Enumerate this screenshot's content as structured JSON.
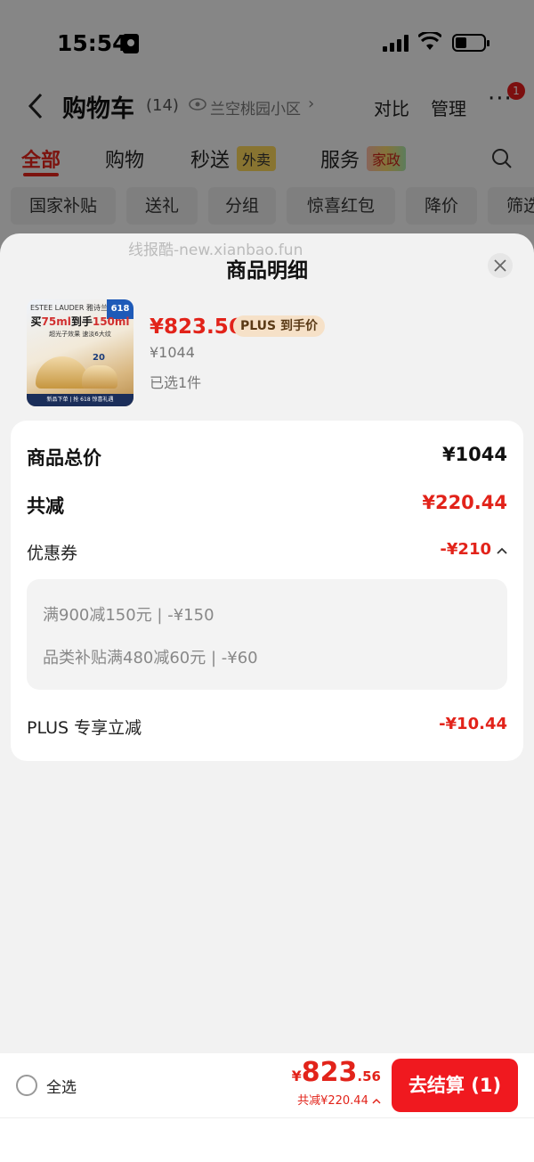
{
  "status_bar": {
    "time": "15:54"
  },
  "nav": {
    "title": "购物车",
    "count": "(14)",
    "location": "兰空桃园小区",
    "compare": "对比",
    "manage": "管理",
    "more": "···",
    "badge": "1"
  },
  "tabs": [
    {
      "label": "全部",
      "active": true
    },
    {
      "label": "购物"
    },
    {
      "label": "秒送",
      "tag": "外卖"
    },
    {
      "label": "服务",
      "tag": "家政"
    }
  ],
  "chips": [
    "国家补贴",
    "送礼",
    "分组",
    "惊喜红包",
    "降价",
    "筛选"
  ],
  "sheet": {
    "watermark": "线报酷-new.xianbao.fun",
    "title": "商品明细",
    "product": {
      "thumb": {
        "brand": "ESTEE LAUDER 雅诗兰黛",
        "badge": "618",
        "headline_a": "买",
        "headline_b": "75ml",
        "headline_c": "到手",
        "headline_d": "150ml",
        "sub": "超光子效果 速淡6大纹",
        "offer": "20",
        "foot": "新品下单 | 抢 618 惊喜礼遇"
      },
      "price": "¥823.56",
      "plus_tag": "PLUS 到手价",
      "original_price": "¥1044",
      "selected": "已选1件"
    },
    "details": {
      "total_label": "商品总价",
      "total_value": "¥1044",
      "reduce_label": "共减",
      "reduce_value": "¥220.44",
      "coupon_label": "优惠券",
      "coupon_value": "-¥210",
      "coupon_items": [
        "满900减150元 | -¥150",
        "品类补贴满480减60元 | -¥60"
      ],
      "plus_label": "PLUS 专享立减",
      "plus_value": "-¥10.44"
    }
  },
  "bottom": {
    "select_all": "全选",
    "price_symbol": "¥",
    "price_int": "823",
    "price_dec": ".56",
    "reduce_text": "共减¥220.44",
    "checkout": "去结算 (1)"
  },
  "colors": {
    "accent": "#e2231a",
    "button": "#f0191f"
  }
}
